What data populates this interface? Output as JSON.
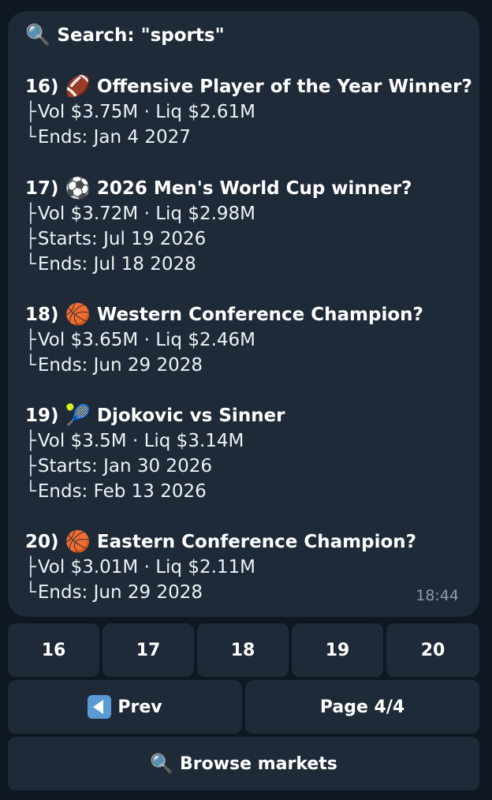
{
  "search": {
    "icon": "🔍",
    "label": "Search: \"sports\""
  },
  "items": [
    {
      "number": "16)",
      "icon": "🏈",
      "title": "Offensive Player of the Year Winner?",
      "lines": [
        {
          "tree": "├",
          "text": "Vol $3.75M · Liq $2.61M"
        },
        {
          "tree": "└",
          "text": "Ends: Jan 4 2027"
        }
      ]
    },
    {
      "number": "17)",
      "icon": "⚽",
      "title": "2026 Men's World Cup winner?",
      "lines": [
        {
          "tree": "├",
          "text": "Vol $3.72M · Liq $2.98M"
        },
        {
          "tree": "├",
          "text": "Starts: Jul 19 2026"
        },
        {
          "tree": "└",
          "text": "Ends: Jul 18 2028"
        }
      ]
    },
    {
      "number": "18)",
      "icon": "🏀",
      "title": "Western Conference Champion?",
      "lines": [
        {
          "tree": "├",
          "text": "Vol $3.65M · Liq $2.46M"
        },
        {
          "tree": "└",
          "text": "Ends: Jun 29 2028"
        }
      ]
    },
    {
      "number": "19)",
      "icon": "🎾",
      "title": "Djokovic vs Sinner",
      "lines": [
        {
          "tree": "├",
          "text": "Vol $3.5M · Liq $3.14M"
        },
        {
          "tree": "├",
          "text": "Starts: Jan 30 2026"
        },
        {
          "tree": "└",
          "text": "Ends: Feb 13 2026"
        }
      ]
    },
    {
      "number": "20)",
      "icon": "🏀",
      "title": "Eastern Conference Champion?",
      "lines": [
        {
          "tree": "├",
          "text": "Vol $3.01M · Liq $2.11M"
        },
        {
          "tree": "└",
          "text": "Ends: Jun 29 2028"
        }
      ]
    }
  ],
  "time": "18:44",
  "buttons": {
    "numbers": [
      "16",
      "17",
      "18",
      "19",
      "20"
    ],
    "prev_icon": "back-arrow-icon",
    "prev": "Prev",
    "page": "Page 4/4",
    "browse_icon": "🔍",
    "browse": "Browse markets"
  }
}
